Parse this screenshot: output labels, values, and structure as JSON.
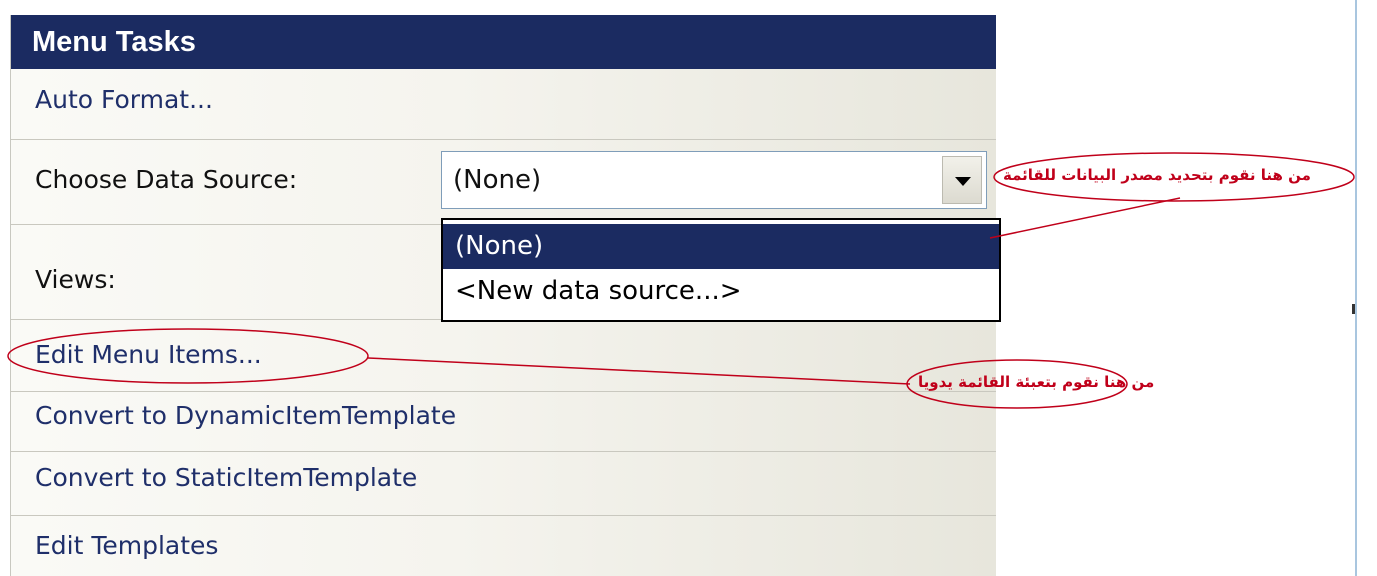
{
  "panel": {
    "title": "Menu Tasks",
    "auto_format": "Auto Format...",
    "data_source_label": "Choose Data Source:",
    "data_source_value": "(None)",
    "data_source_options": [
      "(None)",
      "<New data source...>"
    ],
    "views_label": "Views:",
    "edit_menu_items": "Edit Menu Items...",
    "convert_dynamic": "Convert to DynamicItemTemplate",
    "convert_static": "Convert to StaticItemTemplate",
    "edit_templates": "Edit Templates"
  },
  "annotations": {
    "data_source_note": "من هنا نقوم بتحديد مصدر البيانات للقائمة",
    "menu_items_note": "من هنا نقوم بتعبئة القائمة يدويا"
  },
  "colors": {
    "header": "#1b2b61",
    "annotation": "#c0001a",
    "link": "#1f2f6a"
  }
}
